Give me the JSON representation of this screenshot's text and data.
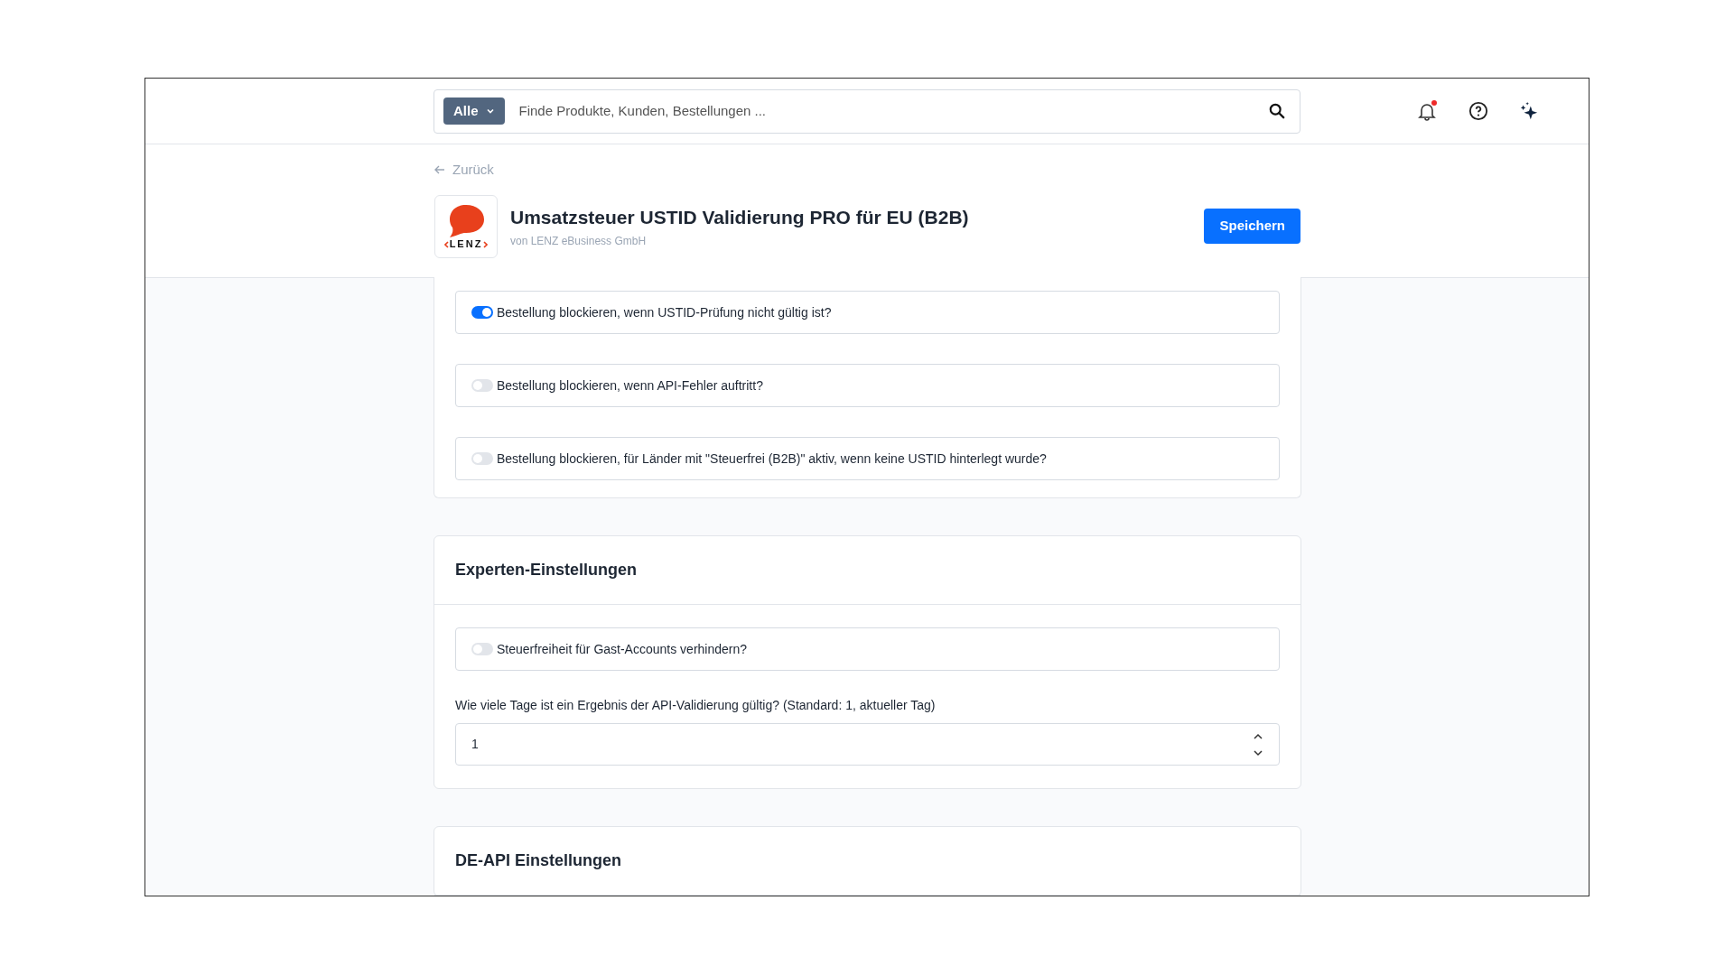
{
  "topbar": {
    "search_scope": "Alle",
    "search": {
      "placeholder": "Finde Produkte, Kunden, Bestellungen ..."
    },
    "notifications_unread": true
  },
  "header": {
    "back_link": "Zurück",
    "title": "Umsatzsteuer USTID Validierung PRO für EU (B2B)",
    "vendor": "von LENZ eBusiness GmbH",
    "logo_text": "LENZ",
    "save_button": "Speichern"
  },
  "sections": [
    {
      "toggles": [
        {
          "label": "Bestellung blockieren, wenn USTID-Prüfung nicht gültig ist?",
          "on": true
        },
        {
          "label": "Bestellung blockieren, wenn API-Fehler auftritt?",
          "on": false
        },
        {
          "label": "Bestellung blockieren, für Länder mit \"Steuerfrei (B2B)\" aktiv, wenn keine USTID hinterlegt wurde?",
          "on": false
        }
      ]
    },
    {
      "title": "Experten-Einstellungen",
      "toggles": [
        {
          "label": "Steuerfreiheit für Gast-Accounts verhindern?",
          "on": false
        }
      ],
      "number_field": {
        "label": "Wie viele Tage ist ein Ergebnis der API-Validierung gültig? (Standard: 1, aktueller Tag)",
        "value": "1"
      }
    },
    {
      "title": "DE-API Einstellungen"
    }
  ]
}
